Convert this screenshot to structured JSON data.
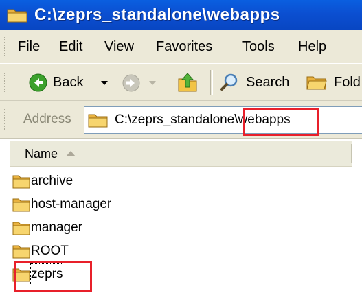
{
  "window": {
    "title": "C:\\zeprs_standalone\\webapps"
  },
  "menu": [
    "File",
    "Edit",
    "View",
    "Favorites",
    "Tools",
    "Help"
  ],
  "toolbar": {
    "back_label": "Back",
    "search_label": "Search",
    "folders_label": "Fold"
  },
  "address": {
    "label": "Address",
    "value": "C:\\zeprs_standalone\\webapps"
  },
  "list": {
    "column_name": "Name",
    "items": [
      "archive",
      "host-manager",
      "manager",
      "ROOT",
      "zeprs"
    ]
  },
  "icons": {
    "folder": "folder-icon",
    "back": "back-arrow-icon",
    "forward": "forward-arrow-icon",
    "up": "up-folder-icon",
    "search": "search-icon"
  },
  "colors": {
    "titlebar": "#0b4fd1",
    "highlight": "#e8202a",
    "toolbar_bg": "#ece9d8"
  }
}
